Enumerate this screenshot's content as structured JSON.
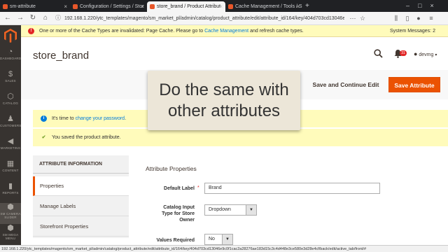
{
  "browser": {
    "tabs": [
      {
        "label": "sm-attribute"
      },
      {
        "label": "Configuration / Settings / Stor"
      },
      {
        "label": "store_brand / Product Attribut"
      },
      {
        "label": "Cache Management / Tools / S"
      }
    ],
    "url": "192.168.1.220/ytc_templates/magento/sm_market_pl/admin/catalog/product_attribute/edit/attribute_id/164/key/404d703cd13046e9c0f...",
    "status_url": "192.168.1.220/ytc_templates/magento/sm_market_pl/admin/catalog/product_attribute/edit/attribute_id/164/key/404d703cd13046e9c0f1cac2a28276ae183d15c3c4d448e3ce580e3d28e4cf/back/edit/active_tab/front/#"
  },
  "sidebar": {
    "items": [
      {
        "label": "DASHBOARD",
        "icon": "dashboard-icon"
      },
      {
        "label": "SALES",
        "icon": "dollar-icon"
      },
      {
        "label": "CATALOG",
        "icon": "cube-icon"
      },
      {
        "label": "CUSTOMERS",
        "icon": "person-icon"
      },
      {
        "label": "MARKETING",
        "icon": "megaphone-icon"
      },
      {
        "label": "CONTENT",
        "icon": "layout-icon"
      },
      {
        "label": "REPORTS",
        "icon": "bar-chart-icon"
      },
      {
        "label": "SM CAMERA SLIDER",
        "icon": "hexagon-icon"
      },
      {
        "label": "SM MEGA MENU",
        "icon": "hexagon-icon"
      }
    ]
  },
  "system_message": {
    "text_before": "One or more of the Cache Types are invalidated: Page Cache. Please go to",
    "link": "Cache Management",
    "text_after": "and refresh cache types.",
    "counter": "System Messages: 2"
  },
  "header": {
    "title": "store_brand",
    "notifications": "31",
    "user": "devmg"
  },
  "actions": {
    "continue_label": "Save and Continue Edit",
    "save_label": "Save Attribute"
  },
  "overlay": {
    "line1": "Do the same with",
    "line2": "other attributes"
  },
  "messages": {
    "info_before": "It's time to",
    "info_link": "change your password",
    "info_after": ".",
    "success": "You saved the product attribute."
  },
  "tabs": {
    "heading": "ATTRIBUTE INFORMATION",
    "items": [
      "Properties",
      "Manage Labels",
      "Storefront Properties"
    ]
  },
  "form": {
    "section_title": "Attribute Properties",
    "default_label": {
      "label": "Default Label",
      "value": "Brand"
    },
    "input_type": {
      "label_1": "Catalog Input",
      "label_2": "Type for Store",
      "label_3": "Owner",
      "value": "Dropdown"
    },
    "values_required": {
      "label": "Values Required",
      "value": "No"
    }
  },
  "colors": {
    "accent": "#eb5202",
    "sidebar": "#373330",
    "notice": "#fffbbb"
  }
}
